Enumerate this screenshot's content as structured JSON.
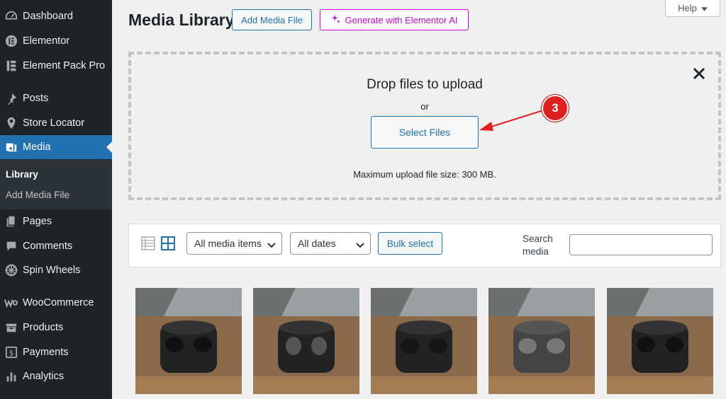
{
  "sidebar": {
    "items": [
      {
        "label": "Dashboard",
        "icon": "dashboard-icon"
      },
      {
        "label": "Elementor",
        "icon": "elementor-icon"
      },
      {
        "label": "Element Pack Pro",
        "icon": "element-pack-icon"
      },
      {
        "label": "Posts",
        "icon": "pin-icon"
      },
      {
        "label": "Store Locator",
        "icon": "location-icon"
      },
      {
        "label": "Media",
        "icon": "media-icon",
        "active": true
      },
      {
        "label": "Pages",
        "icon": "pages-icon"
      },
      {
        "label": "Comments",
        "icon": "comments-icon"
      },
      {
        "label": "Spin Wheels",
        "icon": "wheel-icon"
      },
      {
        "label": "WooCommerce",
        "icon": "woocommerce-icon"
      },
      {
        "label": "Products",
        "icon": "products-icon"
      },
      {
        "label": "Payments",
        "icon": "payments-icon"
      },
      {
        "label": "Analytics",
        "icon": "analytics-icon"
      }
    ],
    "submenu": [
      {
        "label": "Library",
        "current": true
      },
      {
        "label": "Add Media File"
      }
    ]
  },
  "header": {
    "title": "Media Library",
    "add_button": "Add Media File",
    "ai_button": "Generate with Elementor AI",
    "help": "Help"
  },
  "upload": {
    "title": "Drop files to upload",
    "or": "or",
    "select_button": "Select Files",
    "max_size": "Maximum upload file size: 300 MB."
  },
  "annotation": {
    "step": "3"
  },
  "toolbar": {
    "type_filter": "All media items",
    "date_filter": "All dates",
    "bulk_select": "Bulk select",
    "search_label": "Search media",
    "search_value": ""
  },
  "colors": {
    "sidebar_bg": "#1d2327",
    "accent": "#2271b1",
    "ai_accent": "#c00cc8",
    "badge": "#e02020"
  }
}
